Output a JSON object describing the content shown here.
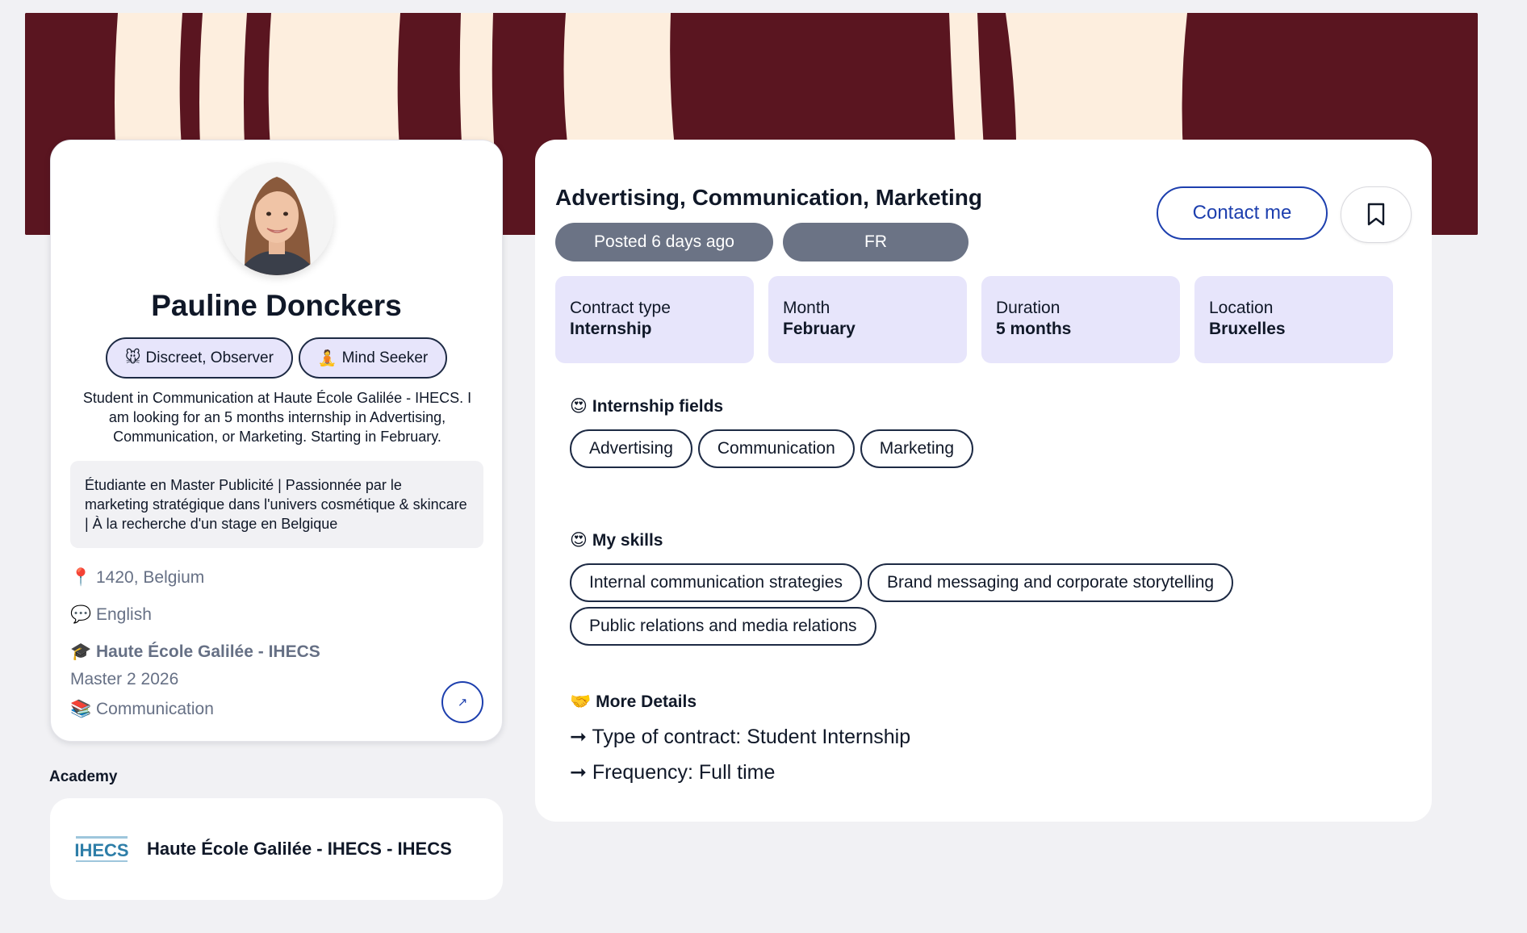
{
  "profile": {
    "name": "Pauline Donckers",
    "badges": [
      {
        "icon": "🐭",
        "label": "Discreet, Observer"
      },
      {
        "icon": "🧘",
        "label": "Mind Seeker"
      }
    ],
    "bio": "Student in Communication at Haute École Galilée - IHECS. I am looking for an 5 months internship in Advertising, Communication, or Marketing. Starting in February.",
    "headline": "Étudiante en Master Publicité | Passionnée par le marketing stratégique dans l'univers cosmétique & skincare | À la recherche d'un stage en Belgique",
    "location": "1420, Belgium",
    "language": "English",
    "school": "Haute École Galilée - IHECS",
    "degree": "Master 2 2026",
    "field": "Communication",
    "icons": {
      "location": "📍",
      "language": "💬",
      "school": "🎓",
      "field": "📚",
      "open": "↗"
    }
  },
  "academy": {
    "label": "Academy",
    "name": "Haute École Galilée - IHECS - IHECS",
    "logo_text": "IHECS",
    "logo_color": "#2e7ea8"
  },
  "listing": {
    "title": "Advertising, Communication, Marketing",
    "posted": "Posted 6 days ago",
    "lang": "FR",
    "contact_label": "Contact me",
    "stats": [
      {
        "label": "Contract type",
        "value": "Internship"
      },
      {
        "label": "Month",
        "value": "February"
      },
      {
        "label": "Duration",
        "value": "5 months"
      },
      {
        "label": "Location",
        "value": "Bruxelles"
      }
    ],
    "fields_title": "Internship fields",
    "fields_icon": "😍",
    "fields": [
      "Advertising",
      "Communication",
      "Marketing"
    ],
    "skills_title": "My skills",
    "skills_icon": "😍",
    "skills": [
      "Internal communication strategies",
      "Brand messaging and corporate storytelling",
      "Public relations and media relations"
    ],
    "details_title": "More Details",
    "details_icon": "🤝",
    "details": [
      "➞ Type of contract:  Student Internship",
      "➞ Frequency:  Full time"
    ]
  },
  "colors": {
    "accent": "#1d3fae",
    "banner": "#5a1520",
    "banner_stripe": "#fdeede",
    "stat_bg": "#e7e5fb",
    "pill_bg": "#6b7385"
  }
}
